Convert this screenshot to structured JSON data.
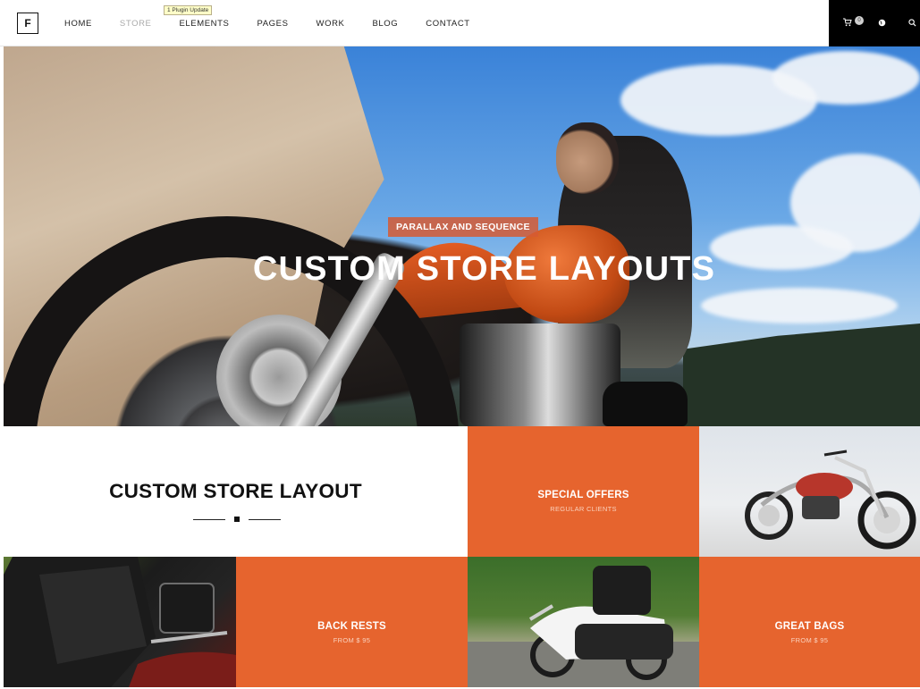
{
  "header": {
    "logo": "F",
    "nav": [
      "HOME",
      "STORE",
      "ELEMENTS",
      "PAGES",
      "WORK",
      "BLOG",
      "CONTACT"
    ],
    "active_nav": "STORE",
    "tooltip": "1 Plugin Update",
    "cart_count": "0"
  },
  "hero": {
    "tag": "PARALLAX AND SEQUENCE",
    "title": "CUSTOM STORE LAYOUTS"
  },
  "store": {
    "title": "CUSTOM STORE LAYOUT"
  },
  "tiles": {
    "special": {
      "title": "SPECIAL OFFERS",
      "sub": "REGULAR CLIENTS"
    },
    "backrests": {
      "title": "BACK RESTS",
      "sub": "FROM $ 95"
    },
    "bags": {
      "title": "GREAT BAGS",
      "sub": "FROM $ 95"
    }
  },
  "colors": {
    "accent": "#e6642e",
    "header_tools_bg": "#000000"
  },
  "icons": [
    "cart-icon",
    "globe-icon",
    "search-icon"
  ]
}
